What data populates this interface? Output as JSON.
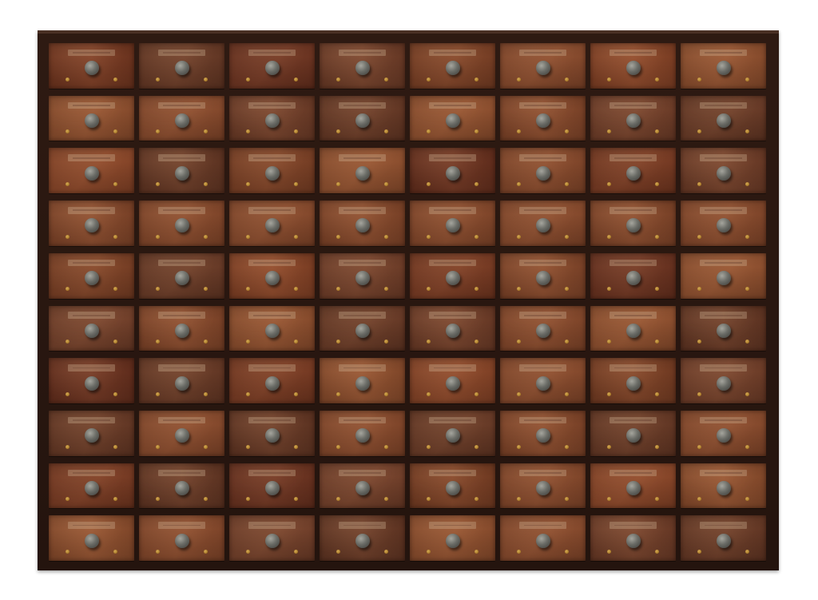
{
  "scene": {
    "subject": "wooden-apothecary-cabinet",
    "background_color": "#ffffff"
  },
  "cabinet": {
    "rows": 10,
    "columns": 8,
    "frame_color": "#2a1710",
    "drawer_colors": [
      "#7a3a22",
      "#8a4a2c",
      "#6e3320",
      "#93512f",
      "#804226",
      "#6a3a26",
      "#8c4628",
      "#75402a"
    ],
    "knob_color": "#7d7f79",
    "screw_color": "#c8922e"
  }
}
